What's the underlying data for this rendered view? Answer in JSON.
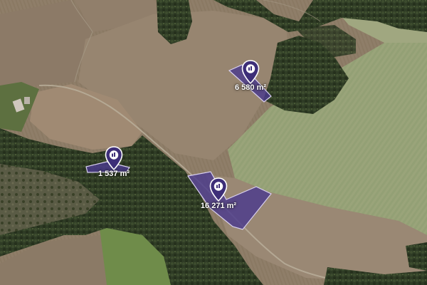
{
  "map": {
    "parcels": [
      {
        "id": "parcel-west",
        "area_label": "1 537 m²"
      },
      {
        "id": "parcel-northeast",
        "area_label": "6 580 m²"
      },
      {
        "id": "parcel-south",
        "area_label": "16 271 m²"
      }
    ],
    "colors": {
      "parcel_fill": "#4b3a8c",
      "parcel_stroke": "#d8d0f0",
      "pin_fill": "#3d2e78",
      "field_brown": "#8e7d68",
      "field_green": "#9aa37a",
      "forest": "#2d3a22",
      "meadow": "#6f8a4a"
    },
    "icons": {
      "pin": "map-marker-icon",
      "land": "land-parcel-icon"
    }
  }
}
